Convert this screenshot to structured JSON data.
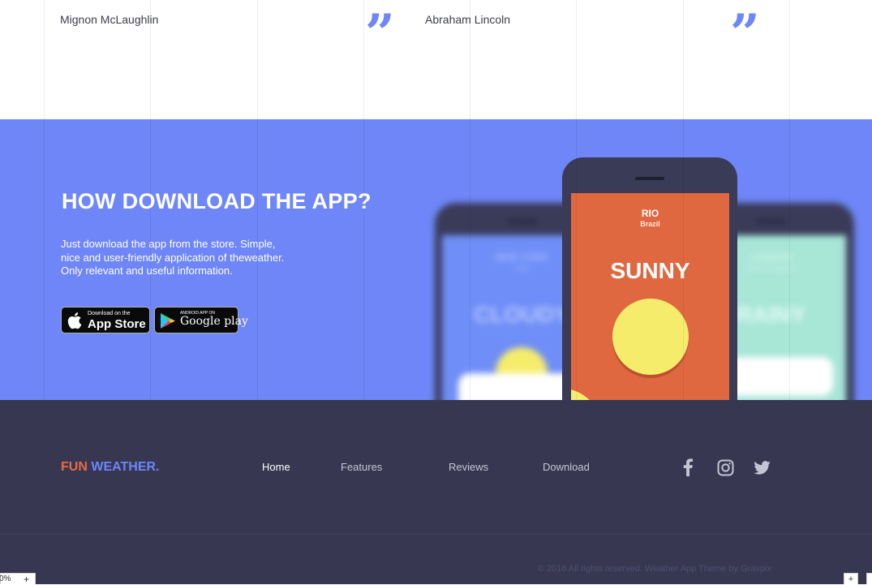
{
  "testimonials": {
    "items": [
      {
        "author": "Mignon McLaughlin",
        "quote_mark": "”"
      },
      {
        "author": "Abraham Lincoln",
        "quote_mark": "”"
      }
    ]
  },
  "download": {
    "title": "HOW DOWNLOAD THE APP?",
    "description": "Just download the app from the store. Simple, nice and user-friendly application of theweather. Only relevant and useful information.",
    "app_store": {
      "small": "Download on the",
      "big": "App Store"
    },
    "google_play": {
      "small": "ANDROID APP ON",
      "big": "Google play"
    }
  },
  "phones": {
    "left": {
      "city": "NEW YORK",
      "country": "USA",
      "condition": "CLOUDY",
      "color": "#6f8ef7"
    },
    "center": {
      "city": "RIO",
      "country": "Brazil",
      "condition": "SUNNY",
      "color": "#e06840"
    },
    "right": {
      "city": "LONDON",
      "country": "United Kingdom",
      "condition": "RAINY",
      "color": "#a8e6d6"
    }
  },
  "footer": {
    "logo": {
      "part1": "FUN",
      "part2": "WEATHER.",
      "color1": "#ec6a43",
      "color2": "#6e86f7"
    },
    "nav": [
      "Home",
      "Features",
      "Reviews",
      "Download"
    ],
    "social": [
      {
        "name": "facebook-icon"
      },
      {
        "name": "instagram-icon"
      },
      {
        "name": "twitter-icon"
      }
    ],
    "copyright": "© 2016 All rights reserved. Weather App Theme by Gravpix"
  },
  "zoom": {
    "level": "0%",
    "plus": "+"
  },
  "corner_buttons": [
    "+",
    ""
  ],
  "colors": {
    "accent": "#6e86f7",
    "footer_bg": "#373751",
    "sunny": "#e06840",
    "sun": "#f6ec6c"
  }
}
